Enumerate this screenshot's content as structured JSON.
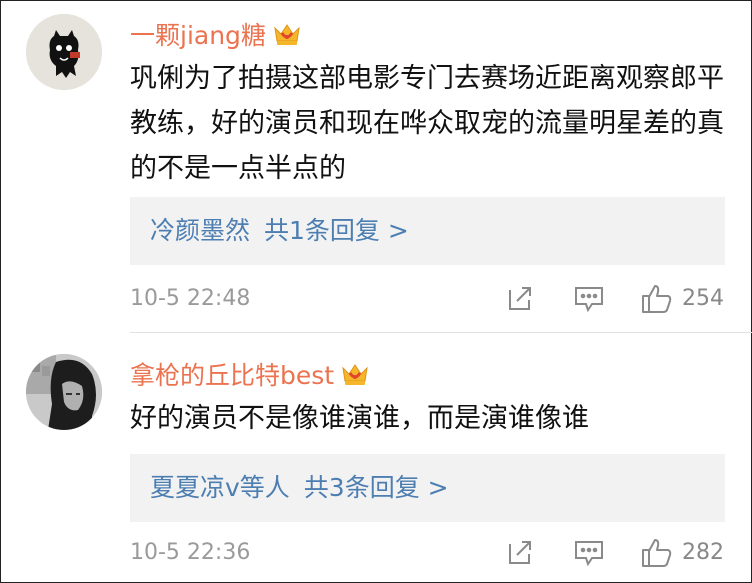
{
  "comments": [
    {
      "username": "一颗jiang糖",
      "text": "巩俐为了拍摄这部电影专门去赛场近距离观察郎平教练，好的演员和现在哗众取宠的流量明星差的真的不是一点半点的",
      "replies": {
        "people": "冷颜墨然",
        "count_text": "共1条回复 >"
      },
      "timestamp": "10-5 22:48",
      "likes": "254"
    },
    {
      "username": "拿枪的丘比特best",
      "text": "好的演员不是像谁演谁，而是演谁像谁",
      "replies": {
        "people": "夏夏凉v等人",
        "count_text": "共3条回复 >"
      },
      "timestamp": "10-5 22:36",
      "likes": "282"
    }
  ],
  "icons": {
    "badge": "crown-badge-icon",
    "share": "share-icon",
    "reply": "comment-icon",
    "like": "thumbs-up-icon"
  },
  "colors": {
    "username": "#eb7350",
    "link": "#4d7eb2",
    "reply_bg": "#f2f2f2",
    "meta": "#9a9a9a"
  }
}
